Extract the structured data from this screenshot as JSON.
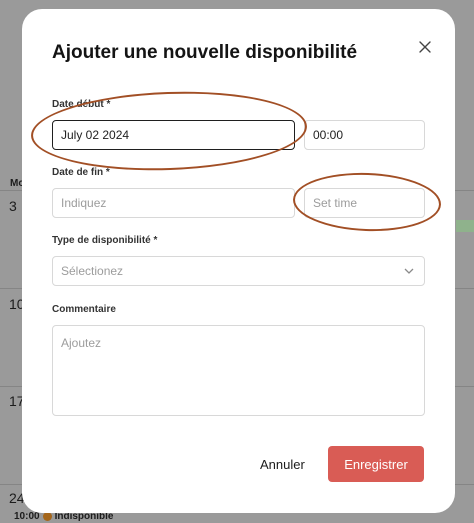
{
  "background": {
    "month_abbrev": "Mo",
    "day_numbers": [
      "3",
      "10",
      "17",
      "24"
    ],
    "event": {
      "time": "10:00",
      "label": "Indisponible"
    }
  },
  "modal": {
    "title": "Ajouter une nouvelle disponibilité",
    "start_date": {
      "label": "Date début *",
      "value": "July 02 2024",
      "time_value": "00:00"
    },
    "end_date": {
      "label": "Date de fin *",
      "placeholder": "Indiquez",
      "time_placeholder": "Set time"
    },
    "availability_type": {
      "label": "Type de disponibilité *",
      "placeholder": "Sélectionez"
    },
    "comment": {
      "label": "Commentaire",
      "placeholder": "Ajoutez"
    },
    "cancel_label": "Annuler",
    "save_label": "Enregistrer"
  },
  "colors": {
    "save_button": "#d95c55",
    "annotation": "#a24f25",
    "overlay": "#9a9a9a"
  }
}
